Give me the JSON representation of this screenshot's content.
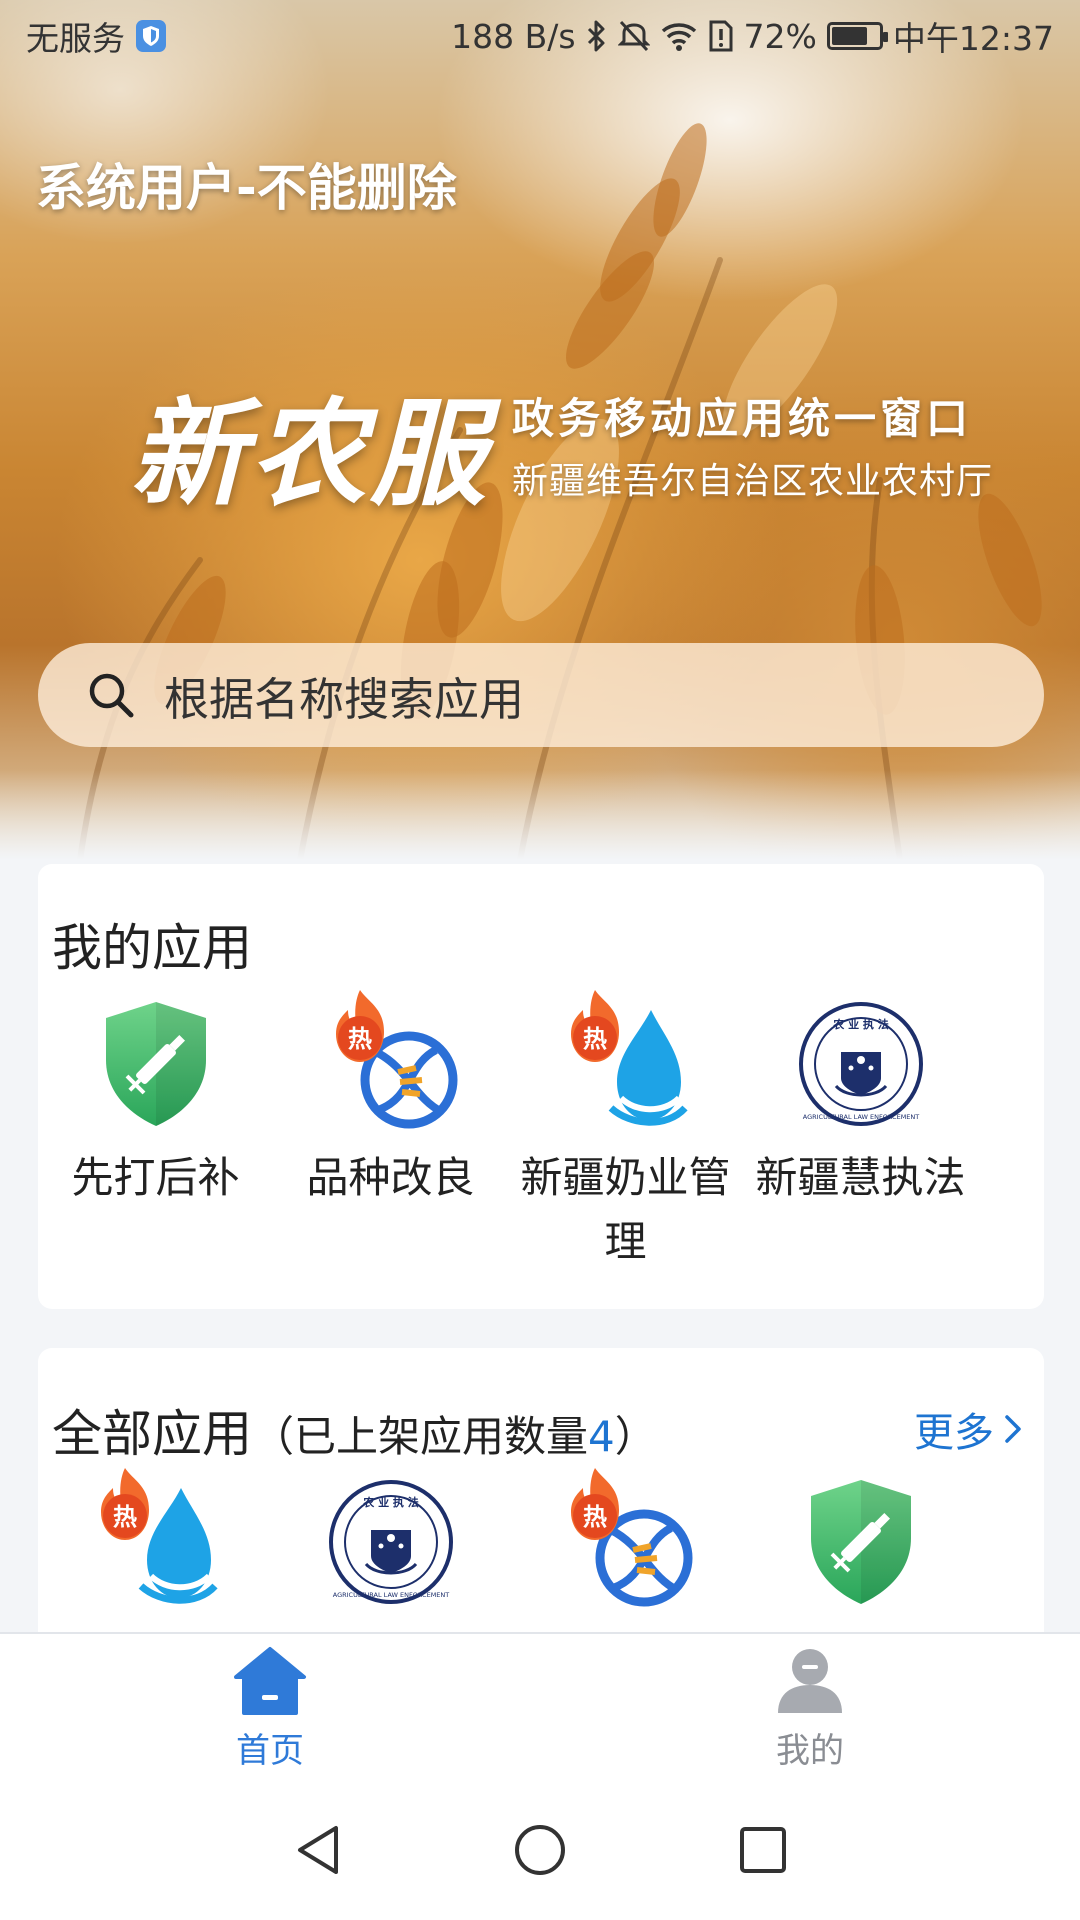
{
  "status_bar": {
    "carrier": "无服务",
    "network_speed": "188 B/s",
    "battery": "72%",
    "time": "中午12:37"
  },
  "header": {
    "user_title": "系统用户-不能删除",
    "brand_logo": "新农服",
    "brand_line1": "政务移动应用统一窗口",
    "brand_line2": "新疆维吾尔自治区农业农村厅"
  },
  "search": {
    "placeholder": "根据名称搜索应用"
  },
  "my_apps": {
    "title": "我的应用",
    "items": [
      {
        "label": "先打后补",
        "icon": "vaccine-shield-icon",
        "hot": false
      },
      {
        "label": "品种改良",
        "icon": "dna-icon",
        "hot": true
      },
      {
        "label": "新疆奶业管理",
        "icon": "water-drop-icon",
        "hot": true
      },
      {
        "label": "新疆慧执法",
        "icon": "law-enforcement-emblem-icon",
        "hot": false
      }
    ]
  },
  "all_apps": {
    "title": "全部应用",
    "count_prefix": "（已上架应用数量",
    "count": "4",
    "count_suffix": "）",
    "more_label": "更多",
    "items": [
      {
        "icon": "water-drop-icon",
        "hot": true
      },
      {
        "icon": "law-enforcement-emblem-icon",
        "hot": false
      },
      {
        "icon": "dna-icon",
        "hot": true
      },
      {
        "icon": "vaccine-shield-icon",
        "hot": false
      }
    ]
  },
  "hot_badge_label": "热",
  "emblem_text": {
    "top": "农 业 执 法",
    "ring": "AGRICULTURAL LAW ENFORCEMENT"
  },
  "tabbar": {
    "home_label": "首页",
    "mine_label": "我的",
    "active": "home"
  },
  "colors": {
    "accent": "#2f7ad8",
    "link": "#1e74d1",
    "hot": "#e4481f",
    "shield_green": "#3cb86a",
    "drop_blue": "#1ea3e6",
    "emblem_navy": "#1d2f6b"
  }
}
